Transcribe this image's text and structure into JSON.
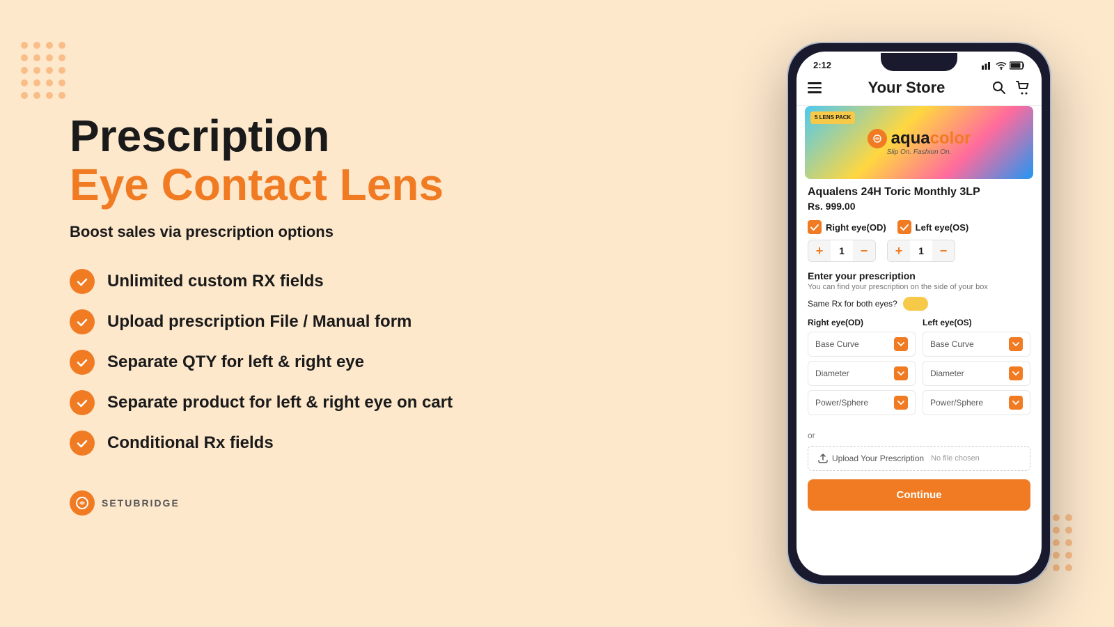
{
  "page": {
    "background_color": "#fde8cc"
  },
  "left": {
    "title_line1": "Prescription",
    "title_line2": "Eye Contact Lens",
    "subtitle": "Boost sales via prescription options",
    "features": [
      "Unlimited custom RX fields",
      "Upload prescription File / Manual form",
      "Separate QTY for left & right eye",
      "Separate product for left & right eye on cart",
      "Conditional Rx fields"
    ],
    "logo_text": "SETUBRIDGE"
  },
  "phone": {
    "status_bar": {
      "time": "2:12",
      "signal": "▌▌",
      "wifi": "wifi",
      "battery": "battery"
    },
    "header": {
      "title": "Your Store",
      "menu_icon": "☰",
      "search_icon": "🔍",
      "cart_icon": "🛒"
    },
    "product": {
      "brand": "aquacolor",
      "tagline": "Slip On. Fashion On.",
      "pack_label": "5\nLENS\nPACK",
      "name": "Aqualens 24H Toric Monthly 3LP",
      "price": "Rs. 999.00"
    },
    "eye_selectors": {
      "right_label": "Right eye(OD)",
      "left_label": "Left eye(OS)"
    },
    "qty": {
      "plus": "+",
      "minus": "−",
      "value": "1"
    },
    "prescription": {
      "title": "Enter your prescription",
      "subtitle": "You can find your prescription on the side of your box",
      "same_rx_label": "Same Rx for both eyes?",
      "right_col_header": "Right eye(OD)",
      "left_col_header": "Left eye(OS)",
      "fields": [
        "Base Curve",
        "Diameter",
        "Power/Sphere"
      ]
    },
    "upload": {
      "button_text": "Upload Your Prescription",
      "filename": "No file chosen"
    },
    "continue_button": "Continue",
    "or_text": "or"
  }
}
